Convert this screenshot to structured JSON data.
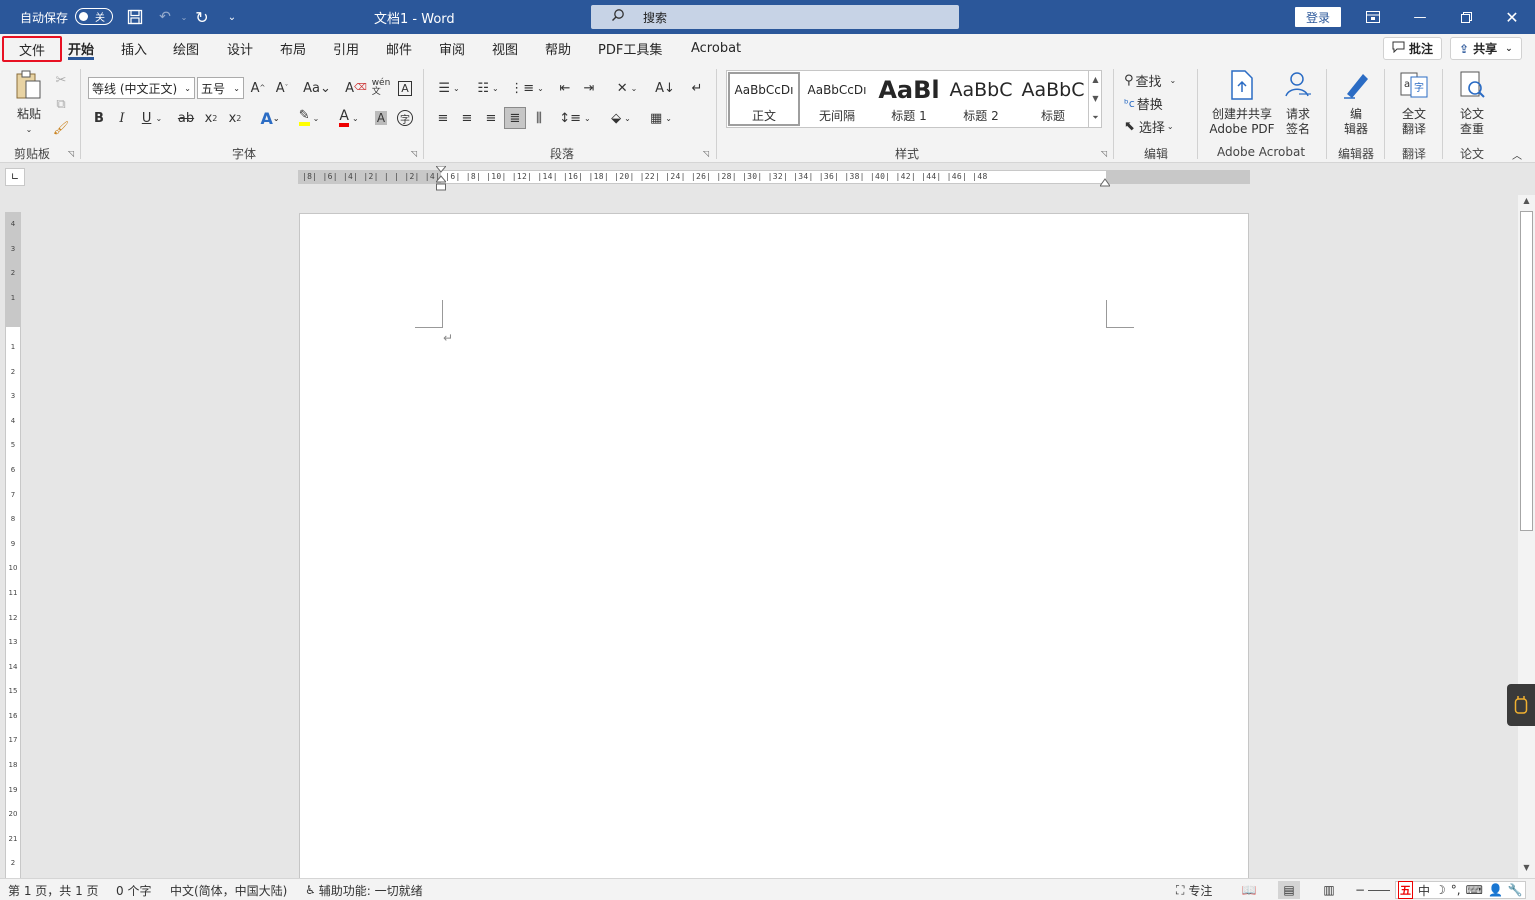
{
  "titlebar": {
    "autosave_label": "自动保存",
    "autosave_state": "关",
    "doc_title": "文档1 - Word",
    "search_placeholder": "搜索",
    "login_label": "登录"
  },
  "tabs": [
    "文件",
    "开始",
    "插入",
    "绘图",
    "设计",
    "布局",
    "引用",
    "邮件",
    "审阅",
    "视图",
    "帮助",
    "PDF工具集",
    "Acrobat"
  ],
  "tabs_right": {
    "comments": "批注",
    "share": "共享"
  },
  "ribbon": {
    "clipboard": {
      "paste": "粘贴",
      "label": "剪贴板"
    },
    "font": {
      "font_name": "等线 (中文正文)",
      "font_size": "五号",
      "label": "字体"
    },
    "paragraph": {
      "label": "段落"
    },
    "styles": {
      "label": "样式",
      "tiles": [
        {
          "preview": "AaBbCcDı",
          "name": "正文"
        },
        {
          "preview": "AaBbCcDı",
          "name": "无间隔"
        },
        {
          "preview": "AaBl",
          "name": "标题 1"
        },
        {
          "preview": "AaBbC",
          "name": "标题 2"
        },
        {
          "preview": "AaBbC",
          "name": "标题"
        }
      ]
    },
    "editing": {
      "find": "查找",
      "replace": "替换",
      "select": "选择",
      "label": "编辑"
    },
    "adobe": {
      "create_share": "创建并共享",
      "adobe_pdf": "Adobe PDF",
      "request": "请求",
      "sign": "签名",
      "label": "Adobe Acrobat"
    },
    "editor": {
      "btn1": "编",
      "btn2": "辑器",
      "label": "编辑器"
    },
    "translate": {
      "btn1": "全文",
      "btn2": "翻译",
      "label": "翻译"
    },
    "paper": {
      "btn1": "论文",
      "btn2": "查重",
      "label": "论文"
    }
  },
  "ruler": {
    "h_numbers": "|8| |6| |4| |2| | |  |2| |4| |6| |8| |10| |12| |14| |16| |18| |20| |22| |24| |26| |28| |30| |32| |34| |36| |38| |40| |42| |44| |46| |48",
    "v_numbers": [
      "4",
      "3",
      "2",
      "1",
      "",
      "1",
      "2",
      "3",
      "4",
      "5",
      "6",
      "7",
      "8",
      "9",
      "10",
      "11",
      "12",
      "13",
      "14",
      "15",
      "16",
      "17",
      "18",
      "19",
      "20",
      "21",
      "2"
    ]
  },
  "statusbar": {
    "page": "第 1 页，共 1 页",
    "words": "0 个字",
    "language": "中文(简体，中国大陆)",
    "accessibility": "辅助功能: 一切就绪",
    "focus": "专注",
    "ime": [
      "中",
      "☽",
      "°,",
      "⌨",
      "👤",
      "🔧"
    ]
  }
}
